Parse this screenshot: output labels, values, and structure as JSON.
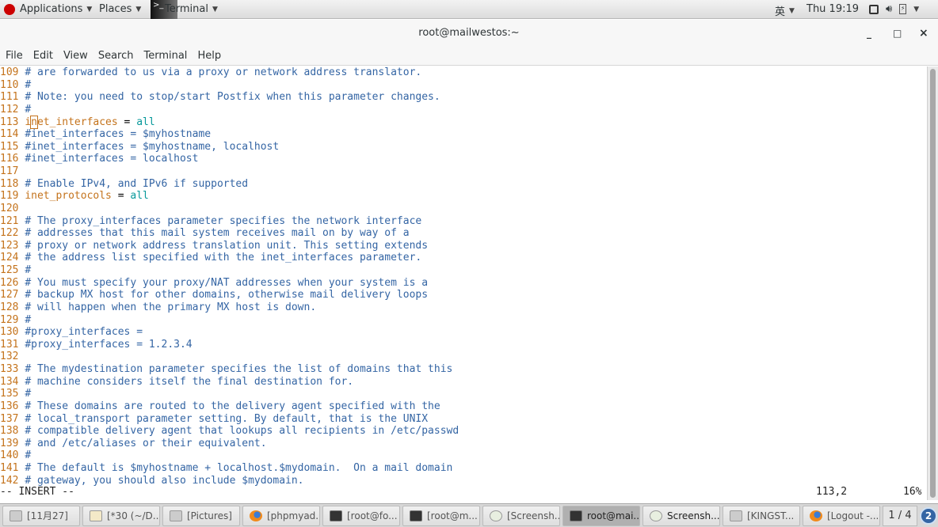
{
  "topbar": {
    "applications": "Applications",
    "places": "Places",
    "terminal": "Terminal",
    "input_method": "英",
    "clock": "Thu 19:19"
  },
  "window": {
    "title": "root@mailwestos:~",
    "minimize": "_",
    "maximize": "□",
    "close": "×"
  },
  "menu": [
    "File",
    "Edit",
    "View",
    "Search",
    "Terminal",
    "Help"
  ],
  "lines": [
    {
      "n": "109",
      "segs": [
        [
          "c",
          "# are forwarded to us via a proxy or network address translator."
        ]
      ]
    },
    {
      "n": "110",
      "segs": [
        [
          "c",
          "#"
        ]
      ]
    },
    {
      "n": "111",
      "segs": [
        [
          "c",
          "# Note: you need to stop/start Postfix when this parameter changes."
        ]
      ]
    },
    {
      "n": "112",
      "segs": [
        [
          "c",
          "#"
        ]
      ]
    },
    {
      "n": "113",
      "segs": [
        [
          "k",
          "i"
        ],
        [
          "cur",
          "n"
        ],
        [
          "k",
          "et_interfaces"
        ],
        [
          "p",
          " = "
        ],
        [
          "v",
          "all"
        ]
      ]
    },
    {
      "n": "114",
      "segs": [
        [
          "c",
          "#inet_interfaces = $myhostname"
        ]
      ]
    },
    {
      "n": "115",
      "segs": [
        [
          "c",
          "#inet_interfaces = $myhostname, localhost"
        ]
      ]
    },
    {
      "n": "116",
      "segs": [
        [
          "c",
          "#inet_interfaces = localhost"
        ]
      ]
    },
    {
      "n": "117",
      "segs": []
    },
    {
      "n": "118",
      "segs": [
        [
          "c",
          "# Enable IPv4, and IPv6 if supported"
        ]
      ]
    },
    {
      "n": "119",
      "segs": [
        [
          "k",
          "inet_protocols"
        ],
        [
          "p",
          " = "
        ],
        [
          "v",
          "all"
        ]
      ]
    },
    {
      "n": "120",
      "segs": []
    },
    {
      "n": "121",
      "segs": [
        [
          "c",
          "# The proxy_interfaces parameter specifies the network interface"
        ]
      ]
    },
    {
      "n": "122",
      "segs": [
        [
          "c",
          "# addresses that this mail system receives mail on by way of a"
        ]
      ]
    },
    {
      "n": "123",
      "segs": [
        [
          "c",
          "# proxy or network address translation unit. This setting extends"
        ]
      ]
    },
    {
      "n": "124",
      "segs": [
        [
          "c",
          "# the address list specified with the inet_interfaces parameter."
        ]
      ]
    },
    {
      "n": "125",
      "segs": [
        [
          "c",
          "#"
        ]
      ]
    },
    {
      "n": "126",
      "segs": [
        [
          "c",
          "# You must specify your proxy/NAT addresses when your system is a"
        ]
      ]
    },
    {
      "n": "127",
      "segs": [
        [
          "c",
          "# backup MX host for other domains, otherwise mail delivery loops"
        ]
      ]
    },
    {
      "n": "128",
      "segs": [
        [
          "c",
          "# will happen when the primary MX host is down."
        ]
      ]
    },
    {
      "n": "129",
      "segs": [
        [
          "c",
          "#"
        ]
      ]
    },
    {
      "n": "130",
      "segs": [
        [
          "c",
          "#proxy_interfaces ="
        ]
      ]
    },
    {
      "n": "131",
      "segs": [
        [
          "c",
          "#proxy_interfaces = 1.2.3.4"
        ]
      ]
    },
    {
      "n": "132",
      "segs": []
    },
    {
      "n": "133",
      "segs": [
        [
          "c",
          "# The mydestination parameter specifies the list of domains that this"
        ]
      ]
    },
    {
      "n": "134",
      "segs": [
        [
          "c",
          "# machine considers itself the final destination for."
        ]
      ]
    },
    {
      "n": "135",
      "segs": [
        [
          "c",
          "#"
        ]
      ]
    },
    {
      "n": "136",
      "segs": [
        [
          "c",
          "# These domains are routed to the delivery agent specified with the"
        ]
      ]
    },
    {
      "n": "137",
      "segs": [
        [
          "c",
          "# local_transport parameter setting. By default, that is the UNIX"
        ]
      ]
    },
    {
      "n": "138",
      "segs": [
        [
          "c",
          "# compatible delivery agent that lookups all recipients in /etc/passwd"
        ]
      ]
    },
    {
      "n": "139",
      "segs": [
        [
          "c",
          "# and /etc/aliases or their equivalent."
        ]
      ]
    },
    {
      "n": "140",
      "segs": [
        [
          "c",
          "#"
        ]
      ]
    },
    {
      "n": "141",
      "segs": [
        [
          "c",
          "# The default is $myhostname + localhost.$mydomain.  On a mail domain"
        ]
      ]
    },
    {
      "n": "142",
      "segs": [
        [
          "c",
          "# gateway, you should also include $mydomain."
        ]
      ]
    }
  ],
  "status": {
    "mode": "-- INSERT --",
    "position": "113,2",
    "percent": "16%"
  },
  "taskbar": {
    "items": [
      {
        "label": "[11月27]",
        "icon": "folder-icon",
        "state": "normal"
      },
      {
        "label": "[*30 (~/D...",
        "icon": "text-editor-icon",
        "state": "normal"
      },
      {
        "label": "[Pictures]",
        "icon": "folder-icon",
        "state": "normal"
      },
      {
        "label": "[phpmyad...",
        "icon": "firefox-icon",
        "state": "normal"
      },
      {
        "label": "[root@fo...",
        "icon": "terminal-icon",
        "state": "normal"
      },
      {
        "label": "[root@m...",
        "icon": "terminal-icon",
        "state": "normal"
      },
      {
        "label": "[Screensh...",
        "icon": "screenshot-icon",
        "state": "normal"
      },
      {
        "label": "root@mai...",
        "icon": "terminal-icon",
        "state": "active"
      },
      {
        "label": "Screensh...",
        "icon": "screenshot-icon",
        "state": "bold"
      },
      {
        "label": "[KINGST...",
        "icon": "folder-icon",
        "state": "normal"
      },
      {
        "label": "[Logout -...",
        "icon": "firefox-icon",
        "state": "normal"
      }
    ],
    "workspace": "1 / 4",
    "notifications": "2"
  },
  "colors": {
    "line_number": "#c4731c",
    "comment": "#3465a4",
    "value": "#06989a"
  }
}
